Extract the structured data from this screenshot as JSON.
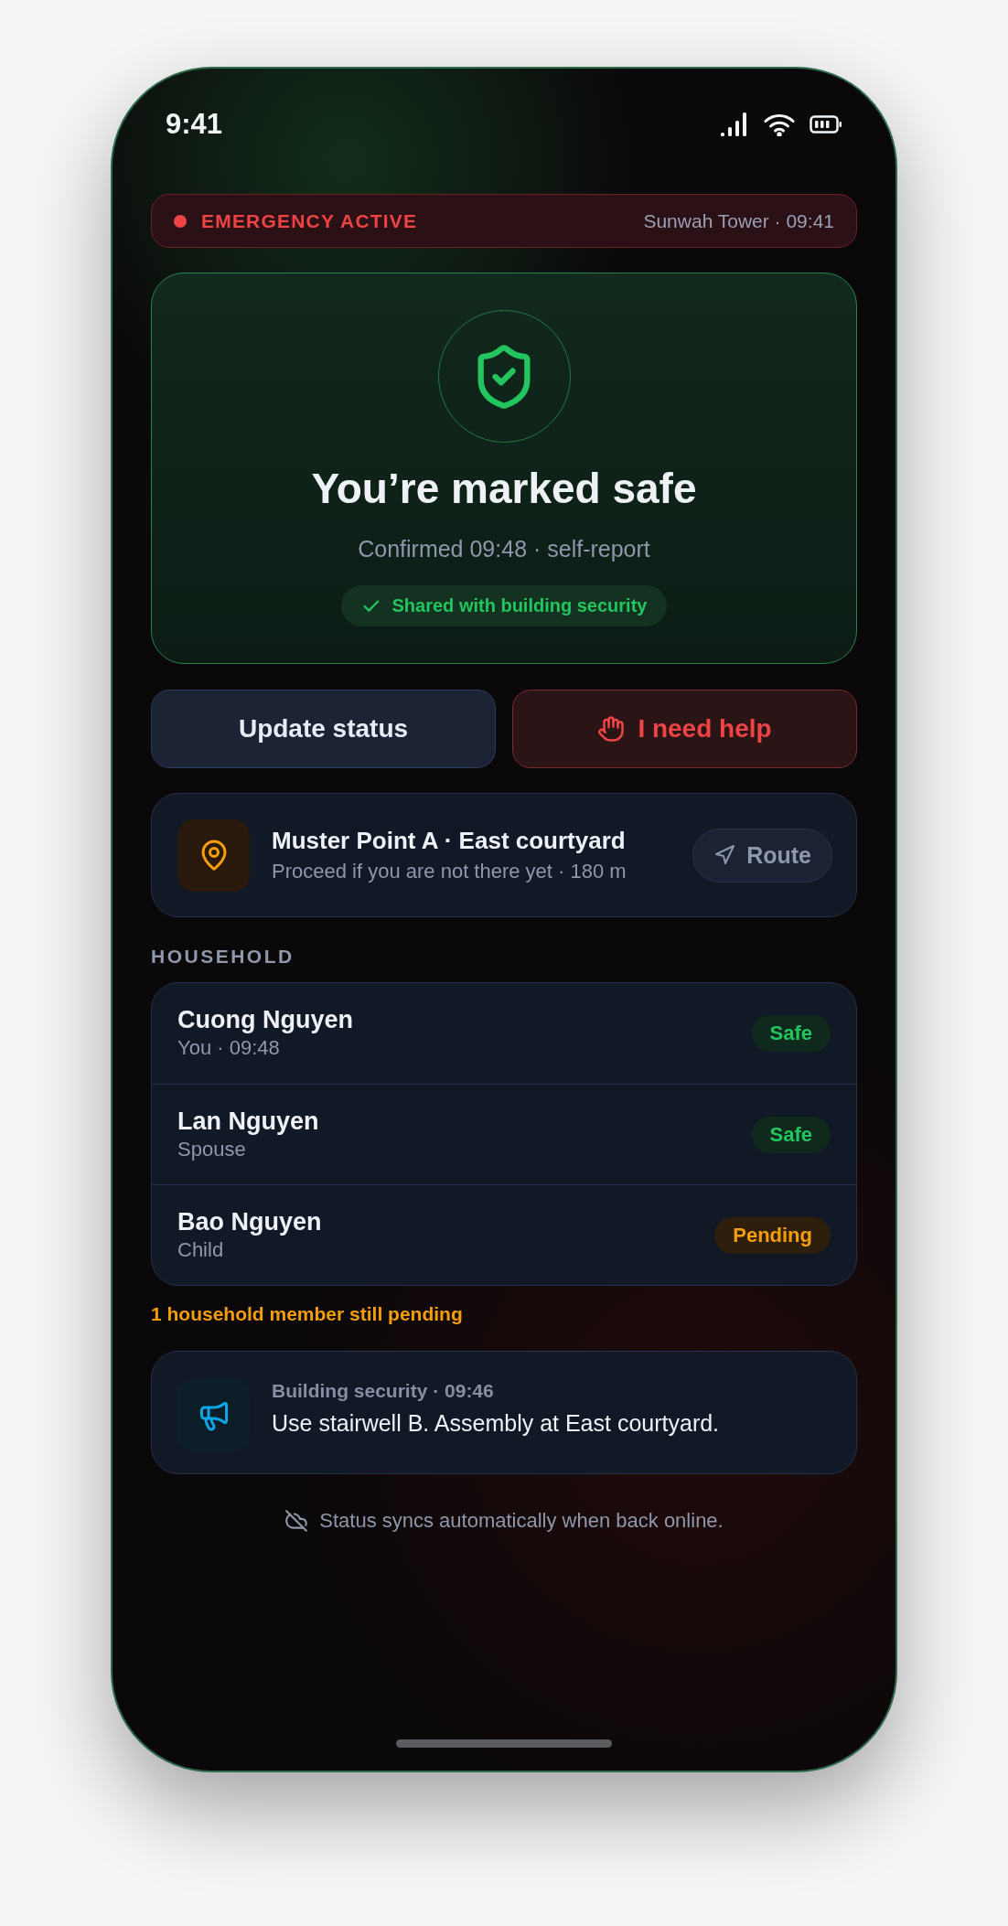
{
  "status_bar": {
    "time": "9:41"
  },
  "alert_banner": {
    "label": "EMERGENCY ACTIVE",
    "location": "Sunwah Tower · 09:41"
  },
  "status_card": {
    "title": "You’re marked safe",
    "subtitle": "Confirmed 09:48 · self-report",
    "shared_note": "Shared with building security"
  },
  "actions": [
    {
      "kind": "secondary",
      "label": "Update status"
    },
    {
      "kind": "danger",
      "label": "I need help"
    }
  ],
  "muster_point": {
    "title": "Muster Point A · East courtyard",
    "subtitle": "Proceed if you are not there yet · 180 m",
    "action": "Route"
  },
  "household": {
    "heading": "HOUSEHOLD",
    "members": [
      {
        "name": "Cuong Nguyen",
        "detail": "You · 09:48",
        "status": "Safe",
        "kind": "safe"
      },
      {
        "name": "Lan Nguyen",
        "detail": "Spouse",
        "status": "Safe",
        "kind": "safe"
      },
      {
        "name": "Bao Nguyen",
        "detail": "Child",
        "status": "Pending",
        "kind": "pending"
      }
    ],
    "pending_note": "1 household member still pending"
  },
  "message": {
    "sender": "Building security · 09:46",
    "text": "Use stairwell B. Assembly at East courtyard."
  },
  "footer": {
    "text": "Status syncs automatically when back online."
  }
}
